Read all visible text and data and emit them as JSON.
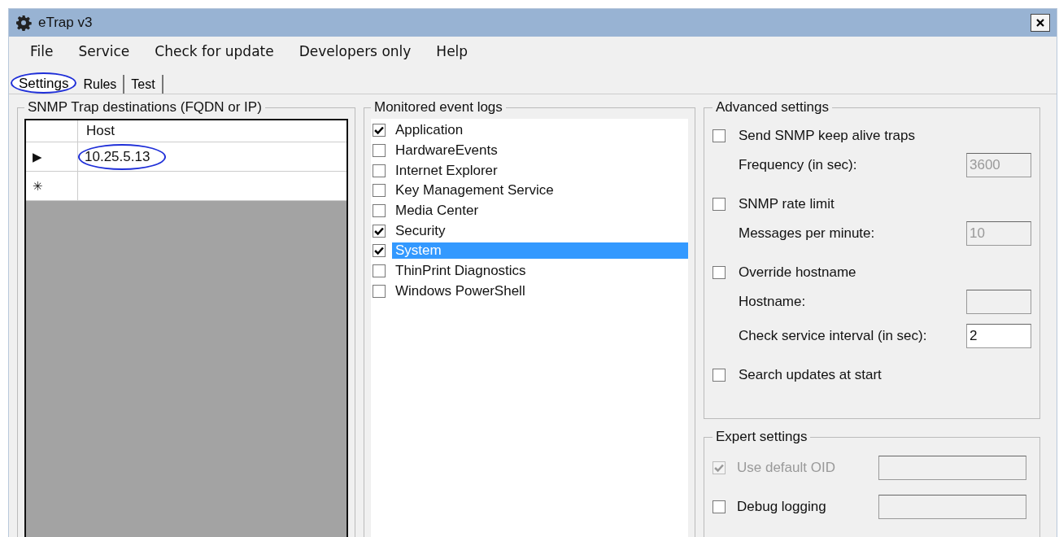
{
  "window": {
    "title": "eTrap v3"
  },
  "menu": [
    "File",
    "Service",
    "Check for update",
    "Developers only",
    "Help"
  ],
  "tabs": [
    {
      "label": "Settings",
      "selected": true,
      "circled": true
    },
    {
      "label": "Rules",
      "selected": false,
      "circled": false
    },
    {
      "label": "Test",
      "selected": false,
      "circled": false
    }
  ],
  "destinations": {
    "title": "SNMP Trap destinations (FQDN or IP)",
    "columns": [
      "Host"
    ],
    "rows": [
      {
        "marker": "▶",
        "host": "10.25.5.13",
        "circled": true
      },
      {
        "marker": "✳"
      }
    ]
  },
  "event_logs": {
    "title": "Monitored event logs",
    "items": [
      {
        "label": "Application",
        "checked": true,
        "selected": false
      },
      {
        "label": "HardwareEvents",
        "checked": false,
        "selected": false
      },
      {
        "label": "Internet Explorer",
        "checked": false,
        "selected": false
      },
      {
        "label": "Key Management Service",
        "checked": false,
        "selected": false
      },
      {
        "label": "Media Center",
        "checked": false,
        "selected": false
      },
      {
        "label": "Security",
        "checked": true,
        "selected": false
      },
      {
        "label": "System",
        "checked": true,
        "selected": true
      },
      {
        "label": "ThinPrint Diagnostics",
        "checked": false,
        "selected": false
      },
      {
        "label": "Windows PowerShell",
        "checked": false,
        "selected": false
      }
    ]
  },
  "advanced": {
    "title": "Advanced settings",
    "items": [
      {
        "kind": "checkbox",
        "label": "Send SNMP keep alive traps",
        "checked": false
      },
      {
        "kind": "field",
        "label": "Frequency (in sec):",
        "value": "3600",
        "disabled": true
      },
      {
        "kind": "checkbox",
        "label": "SNMP rate limit",
        "checked": false
      },
      {
        "kind": "field",
        "label": "Messages per minute:",
        "value": "10",
        "disabled": true
      },
      {
        "kind": "checkbox",
        "label": "Override hostname",
        "checked": false
      },
      {
        "kind": "field",
        "label": "Hostname:",
        "disabled": true
      },
      {
        "kind": "field",
        "label": "Check service interval (in sec):",
        "value": "2",
        "disabled": false
      },
      {
        "kind": "checkbox",
        "label": "Search updates at start",
        "checked": false
      }
    ]
  },
  "expert": {
    "title": "Expert settings",
    "items": [
      {
        "label": "Use default OID",
        "checked": true,
        "disabled": true
      },
      {
        "label": "Debug logging",
        "checked": false,
        "disabled": false
      }
    ]
  }
}
